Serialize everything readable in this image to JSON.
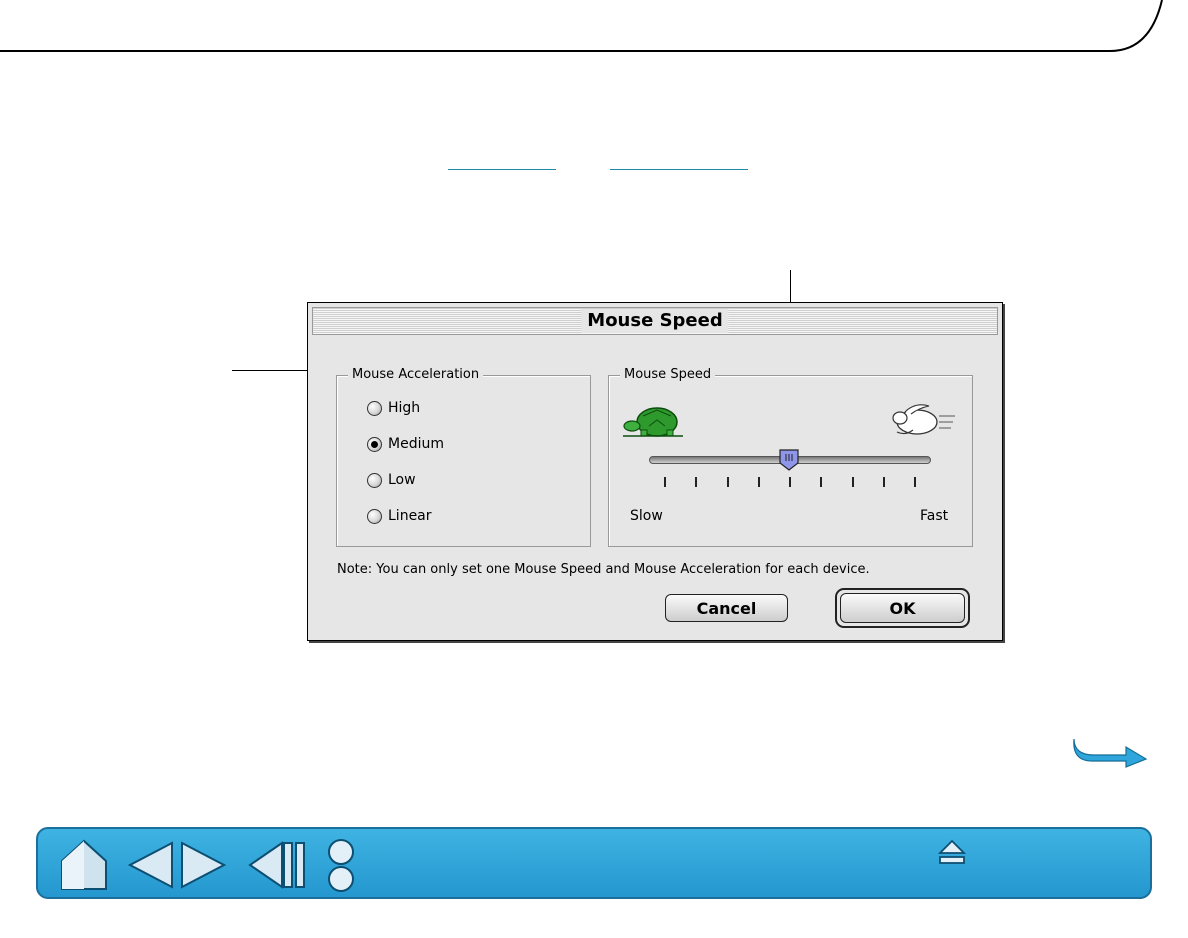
{
  "dialog": {
    "title": "Mouse Speed",
    "acceleration_group": {
      "label": "Mouse Acceleration",
      "options": [
        {
          "label": "High",
          "checked": false
        },
        {
          "label": "Medium",
          "checked": true
        },
        {
          "label": "Low",
          "checked": false
        },
        {
          "label": "Linear",
          "checked": false
        }
      ]
    },
    "speed_group": {
      "label": "Mouse Speed",
      "slow_label": "Slow",
      "fast_label": "Fast",
      "tick_count": 9,
      "value_fraction": 0.5
    },
    "note": "Note: You can only set one Mouse Speed and Mouse Acceleration for each device.",
    "cancel_label": "Cancel",
    "ok_label": "OK"
  },
  "colors": {
    "nav_bar": "#2ea6dc",
    "link": "#1f8aa8",
    "turtle": "#2e9a2e",
    "slider_thumb": "#8f95e8"
  },
  "icons": {
    "home": "home-icon",
    "previous": "arrow-left-icon",
    "next": "arrow-right-icon",
    "back": "back-icon",
    "options": "two-circles-icon",
    "eject": "eject-icon",
    "next_page": "curved-arrow-right-icon"
  }
}
